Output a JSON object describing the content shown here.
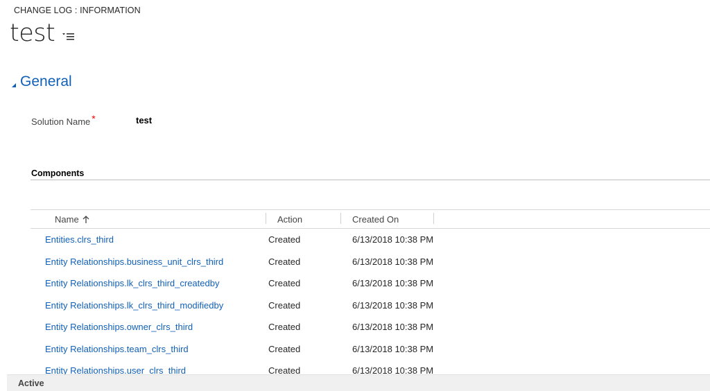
{
  "breadcrumb": "CHANGE LOG : INFORMATION",
  "record": {
    "title": "test"
  },
  "section": {
    "title": "General"
  },
  "fields": {
    "solution_name_label": "Solution Name",
    "required_mark": "*",
    "solution_name_value": "test"
  },
  "components": {
    "label": "Components",
    "columns": {
      "name": "Name",
      "action": "Action",
      "created_on": "Created On"
    },
    "sort": {
      "column": "Name",
      "direction": "ascending"
    },
    "rows": [
      {
        "name": "Entities.clrs_third",
        "action": "Created",
        "created_on": "6/13/2018 10:38 PM"
      },
      {
        "name": "Entity Relationships.business_unit_clrs_third",
        "action": "Created",
        "created_on": "6/13/2018 10:38 PM"
      },
      {
        "name": "Entity Relationships.lk_clrs_third_createdby",
        "action": "Created",
        "created_on": "6/13/2018 10:38 PM"
      },
      {
        "name": "Entity Relationships.lk_clrs_third_modifiedby",
        "action": "Created",
        "created_on": "6/13/2018 10:38 PM"
      },
      {
        "name": "Entity Relationships.owner_clrs_third",
        "action": "Created",
        "created_on": "6/13/2018 10:38 PM"
      },
      {
        "name": "Entity Relationships.team_clrs_third",
        "action": "Created",
        "created_on": "6/13/2018 10:38 PM"
      },
      {
        "name": "Entity Relationships.user_clrs_third",
        "action": "Created",
        "created_on": "6/13/2018 10:38 PM"
      }
    ]
  },
  "status": {
    "text": "Active"
  },
  "colors": {
    "link": "#1160b7",
    "required": "#ee0000",
    "status_bar": "#f0f0f0"
  },
  "icons": {
    "title_menu": "list-menu-icon",
    "section_toggle": "collapse-triangle-icon",
    "sort": "sort-arrow-up-icon"
  }
}
